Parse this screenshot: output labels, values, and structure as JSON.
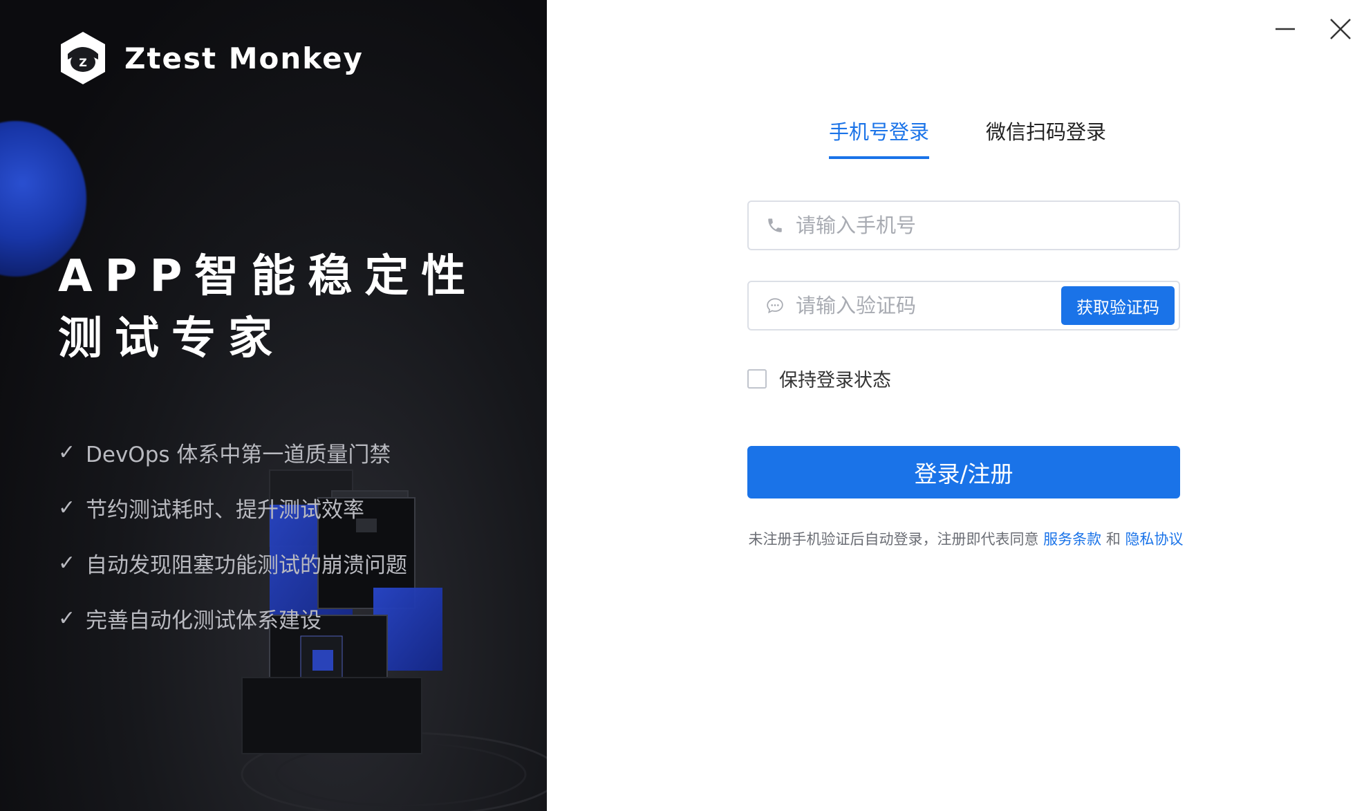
{
  "brand": {
    "name": "Ztest Monkey",
    "badge_letter": "Z"
  },
  "promo": {
    "headline_line1": "APP智能稳定性",
    "headline_line2": "测试专家",
    "features": [
      "DevOps 体系中第一道质量门禁",
      "节约测试耗时、提升测试效率",
      "自动发现阻塞功能测试的崩溃问题",
      "完善自动化测试体系建设"
    ],
    "check_glyph": "✓"
  },
  "window": {
    "minimize_icon": "minimize-icon",
    "close_icon": "close-icon"
  },
  "login": {
    "tabs": [
      {
        "label": "手机号登录",
        "active": true
      },
      {
        "label": "微信扫码登录",
        "active": false
      }
    ],
    "phone": {
      "placeholder": "请输入手机号",
      "value": "",
      "icon": "phone-icon"
    },
    "code": {
      "placeholder": "请输入验证码",
      "value": "",
      "icon": "chat-bubble-icon",
      "button_label": "获取验证码"
    },
    "remember": {
      "label": "保持登录状态",
      "checked": false
    },
    "submit_label": "登录/注册",
    "agreement": {
      "prefix": "未注册手机验证后自动登录，注册即代表同意",
      "terms_link": "服务条款",
      "joiner": "和",
      "privacy_link": "隐私协议"
    }
  },
  "colors": {
    "accent": "#1a73e8",
    "left_bg": "#111215",
    "cube_blue": "#1f3fb8"
  }
}
